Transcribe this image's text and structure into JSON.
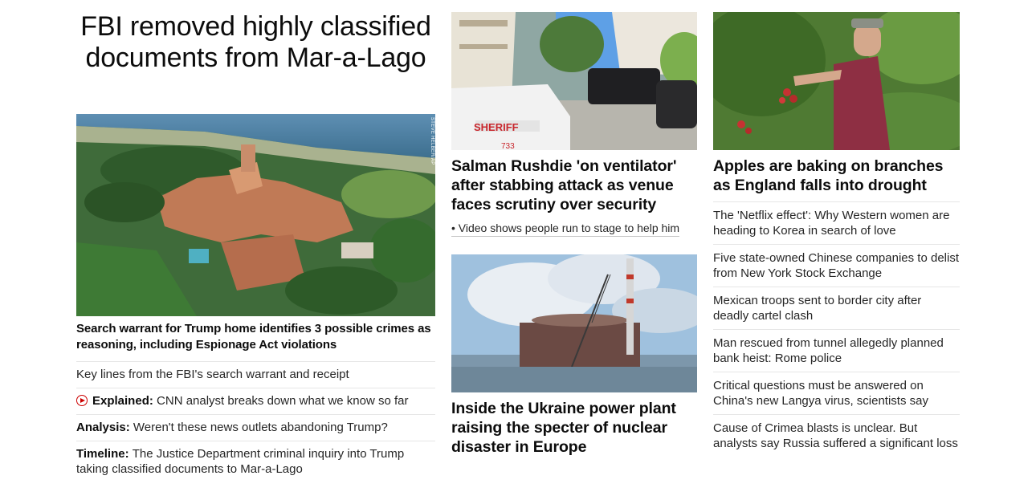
{
  "col1": {
    "headline": "FBI removed highly classified documents from Mar-a-Lago",
    "photo_credit": "STEVE HELBER/AP",
    "lead": "Search warrant for Trump home identifies 3 possible crimes as reasoning, including Espionage Act violations",
    "items": [
      {
        "label": "",
        "text": "Key lines from the FBI's search warrant and receipt",
        "icon": ""
      },
      {
        "label": "Explained:",
        "text": "CNN analyst breaks down what we know so far",
        "icon": "play-icon"
      },
      {
        "label": "Analysis:",
        "text": "Weren't these news outlets abandoning Trump?",
        "icon": ""
      },
      {
        "label": "Timeline:",
        "text": "The Justice Department criminal inquiry into Trump taking classified documents to Mar-a-Lago",
        "icon": ""
      }
    ]
  },
  "col2": {
    "story1_title": "Salman Rushdie 'on ventilator' after stabbing attack as venue faces scrutiny over security",
    "story1_sub": "• Video shows people run to stage to help him",
    "sheriff_text": "SHERIFF",
    "car_number": "733",
    "story2_title": "Inside the Ukraine power plant raising the specter of nuclear disaster in Europe"
  },
  "col3": {
    "story_title": "Apples are baking on branches as England falls into drought",
    "items": [
      "The 'Netflix effect': Why Western women are heading to Korea in search of love",
      "Five state-owned Chinese companies to delist from New York Stock Exchange",
      "Mexican troops sent to border city after deadly cartel clash",
      "Man rescued from tunnel allegedly planned bank heist: Rome police",
      "Critical questions must be answered on China's new Langya virus, scientists say",
      "Cause of Crimea blasts is unclear. But analysts say Russia suffered a significant loss"
    ]
  }
}
